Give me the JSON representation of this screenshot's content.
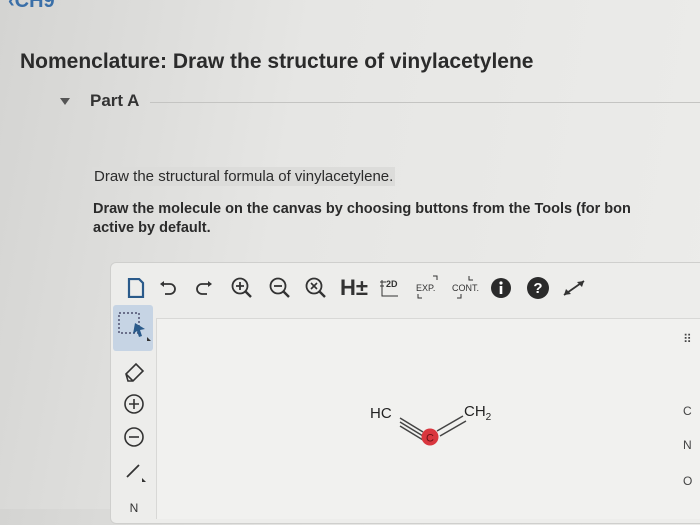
{
  "header": {
    "back_link": "‹CH9",
    "title": "Nomenclature: Draw the structure of vinylacetylene"
  },
  "part": {
    "label": "Part A"
  },
  "instructions": {
    "line1": "Draw the structural formula of vinylacetylene.",
    "line2a": "Draw the molecule on the canvas by choosing buttons from the Tools (for bon",
    "line2b": "active by default."
  },
  "toolbar": {
    "hydrogens_label": "H±",
    "label_2d": "2D",
    "label_exp": "EXP.",
    "label_cont": "CONT."
  },
  "molecule": {
    "left_group": "HC",
    "right_group": "CH",
    "right_sub": "2",
    "center_atom": "C",
    "center_color": "#d9363e"
  },
  "side_tools_labels": {
    "bottom_tool": "N"
  },
  "right_edge": {
    "items": [
      "⠿",
      "C",
      "N",
      "O"
    ]
  },
  "colors": {
    "accent": "#3a6fa8",
    "selected_tool_bg": "#c6d4e4"
  }
}
